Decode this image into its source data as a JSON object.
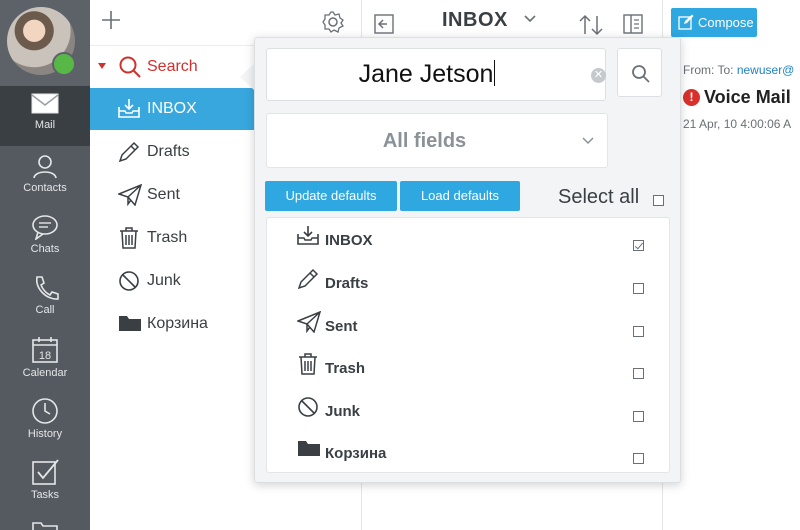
{
  "rail": {
    "items": [
      {
        "label": "Mail",
        "icon": "envelope-icon"
      },
      {
        "label": "Contacts",
        "icon": "person-icon"
      },
      {
        "label": "Chats",
        "icon": "chat-bubble-icon"
      },
      {
        "label": "Call",
        "icon": "phone-icon"
      },
      {
        "label": "Calendar",
        "icon": "calendar-icon",
        "day": "18"
      },
      {
        "label": "History",
        "icon": "clock-icon"
      },
      {
        "label": "Tasks",
        "icon": "checkbox-icon"
      }
    ]
  },
  "folders": {
    "search_label": "Search",
    "items": [
      {
        "label": "INBOX"
      },
      {
        "label": "Drafts"
      },
      {
        "label": "Sent"
      },
      {
        "label": "Trash"
      },
      {
        "label": "Junk"
      },
      {
        "label": "Корзина"
      }
    ]
  },
  "list": {
    "title": "INBOX"
  },
  "reader": {
    "compose_label": "Compose",
    "from_prefix": "From:",
    "to_prefix": "To:",
    "to_address": "newuser@",
    "subject": "Voice Mail",
    "date": "21 Apr, 10 4:00:06 A"
  },
  "popup": {
    "query": "Jane Jetson",
    "fields_value": "All fields",
    "update_defaults": "Update defaults",
    "load_defaults": "Load defaults",
    "select_all": "Select all",
    "folders": [
      {
        "label": "INBOX",
        "checked": true
      },
      {
        "label": "Drafts",
        "checked": false
      },
      {
        "label": "Sent",
        "checked": false
      },
      {
        "label": "Trash",
        "checked": false
      },
      {
        "label": "Junk",
        "checked": false
      },
      {
        "label": "Корзина",
        "checked": false
      }
    ]
  },
  "colors": {
    "accent": "#2fa7e0",
    "rail": "#545a60",
    "search_red": "#d0312d",
    "presence_green": "#58b847"
  }
}
